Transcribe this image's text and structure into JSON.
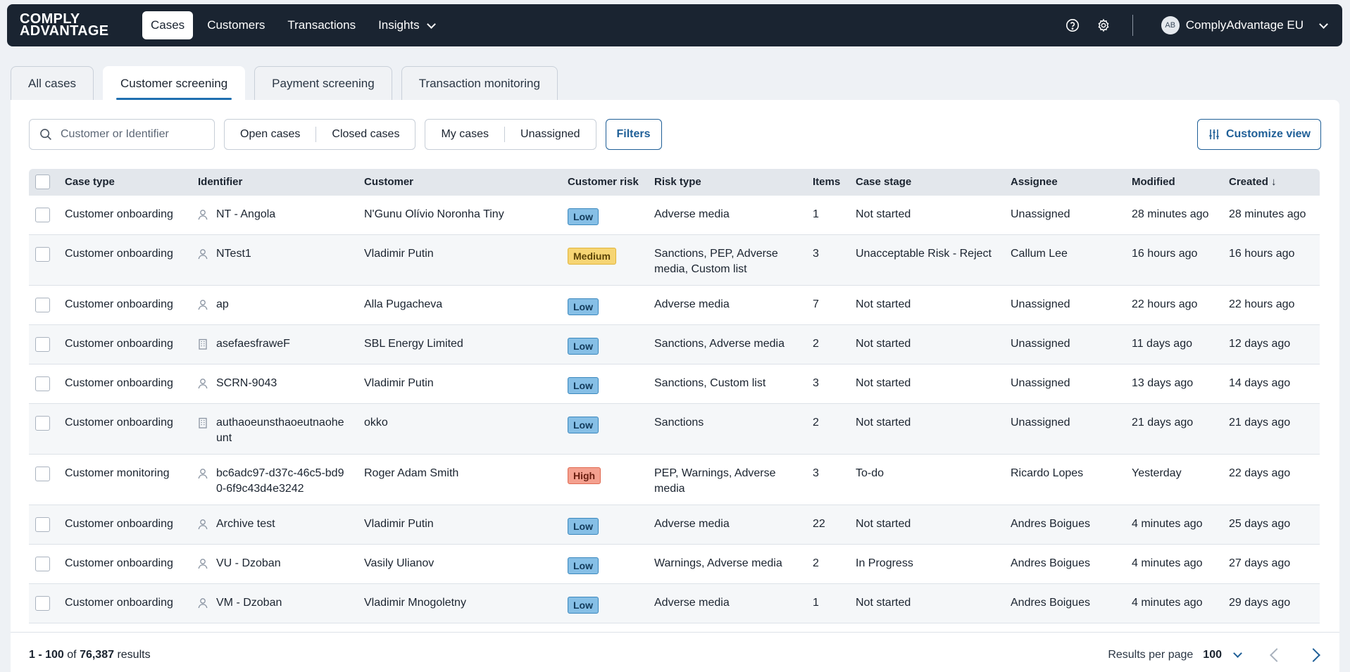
{
  "brand": {
    "line1": "COMPLY",
    "line2": "ADVANTAGE"
  },
  "nav": {
    "items": [
      {
        "label": "Cases",
        "active": true
      },
      {
        "label": "Customers",
        "active": false
      },
      {
        "label": "Transactions",
        "active": false
      },
      {
        "label": "Insights",
        "active": false,
        "dropdown": true
      }
    ],
    "help_icon": "help-circle-icon",
    "settings_icon": "gear-icon",
    "user": {
      "initials": "AB",
      "org": "ComplyAdvantage EU"
    }
  },
  "tabs": [
    {
      "label": "All cases",
      "active": false
    },
    {
      "label": "Customer screening",
      "active": true
    },
    {
      "label": "Payment screening",
      "active": false
    },
    {
      "label": "Transaction monitoring",
      "active": false
    }
  ],
  "toolbar": {
    "search_placeholder": "Customer or Identifier",
    "status_filters": [
      "Open cases",
      "Closed cases"
    ],
    "owner_filters": [
      "My cases",
      "Unassigned"
    ],
    "filters_label": "Filters",
    "customize_label": "Customize view"
  },
  "table": {
    "columns": {
      "type": "Case type",
      "identifier": "Identifier",
      "customer": "Customer",
      "risk": "Customer risk",
      "risk_type": "Risk type",
      "items": "Items",
      "stage": "Case stage",
      "assignee": "Assignee",
      "modified": "Modified",
      "created": "Created",
      "created_sort": "↓"
    },
    "rows": [
      {
        "type": "Customer onboarding",
        "id_kind": "person",
        "identifier": "NT - Angola",
        "customer": "N'Gunu Olívio Noronha Tiny",
        "risk": "Low",
        "risk_type": "Adverse media",
        "items": "1",
        "stage": "Not started",
        "assignee": "Unassigned",
        "modified": "28 minutes ago",
        "created": "28 minutes ago"
      },
      {
        "type": "Customer onboarding",
        "id_kind": "person",
        "identifier": "NTest1",
        "customer": "Vladimir Putin",
        "risk": "Medium",
        "risk_type": "Sanctions, PEP, Adverse media, Custom list",
        "items": "3",
        "stage": "Unacceptable Risk - Reject",
        "assignee": "Callum Lee",
        "modified": "16 hours ago",
        "created": "16 hours ago"
      },
      {
        "type": "Customer onboarding",
        "id_kind": "person",
        "identifier": "ap",
        "customer": "Alla Pugacheva",
        "risk": "Low",
        "risk_type": "Adverse media",
        "items": "7",
        "stage": "Not started",
        "assignee": "Unassigned",
        "modified": "22 hours ago",
        "created": "22 hours ago"
      },
      {
        "type": "Customer onboarding",
        "id_kind": "company",
        "identifier": "asefaesfraweF",
        "customer": "SBL Energy Limited",
        "risk": "Low",
        "risk_type": "Sanctions, Adverse media",
        "items": "2",
        "stage": "Not started",
        "assignee": "Unassigned",
        "modified": "11 days ago",
        "created": "12 days ago"
      },
      {
        "type": "Customer onboarding",
        "id_kind": "person",
        "identifier": "SCRN-9043",
        "customer": "Vladimir Putin",
        "risk": "Low",
        "risk_type": "Sanctions, Custom list",
        "items": "3",
        "stage": "Not started",
        "assignee": "Unassigned",
        "modified": "13 days ago",
        "created": "14 days ago"
      },
      {
        "type": "Customer onboarding",
        "id_kind": "company",
        "identifier": "authaoeunsthaoeutnaoheunt",
        "customer": "okko",
        "risk": "Low",
        "risk_type": "Sanctions",
        "items": "2",
        "stage": "Not started",
        "assignee": "Unassigned",
        "modified": "21 days ago",
        "created": "21 days ago"
      },
      {
        "type": "Customer monitoring",
        "id_kind": "person",
        "identifier": "bc6adc97-d37c-46c5-bd90-6f9c43d4e3242",
        "customer": "Roger Adam Smith",
        "risk": "High",
        "risk_type": "PEP, Warnings, Adverse media",
        "items": "3",
        "stage": "To-do",
        "assignee": "Ricardo Lopes",
        "modified": "Yesterday",
        "created": "22 days ago"
      },
      {
        "type": "Customer onboarding",
        "id_kind": "person",
        "identifier": "Archive test",
        "customer": "Vladimir Putin",
        "risk": "Low",
        "risk_type": "Adverse media",
        "items": "22",
        "stage": "Not started",
        "assignee": "Andres Boigues",
        "modified": "4 minutes ago",
        "created": "25 days ago"
      },
      {
        "type": "Customer onboarding",
        "id_kind": "person",
        "identifier": "VU - Dzoban",
        "customer": "Vasily Ulianov",
        "risk": "Low",
        "risk_type": "Warnings, Adverse media",
        "items": "2",
        "stage": "In Progress",
        "assignee": "Andres Boigues",
        "modified": "4 minutes ago",
        "created": "27 days ago"
      },
      {
        "type": "Customer onboarding",
        "id_kind": "person",
        "identifier": "VM - Dzoban",
        "customer": "Vladimir Mnogoletny",
        "risk": "Low",
        "risk_type": "Adverse media",
        "items": "1",
        "stage": "Not started",
        "assignee": "Andres Boigues",
        "modified": "4 minutes ago",
        "created": "29 days ago"
      }
    ]
  },
  "footer": {
    "range": "1 - 100",
    "of": "of",
    "total": "76,387",
    "results": "results",
    "per_page_label": "Results per page",
    "per_page_value": "100"
  }
}
